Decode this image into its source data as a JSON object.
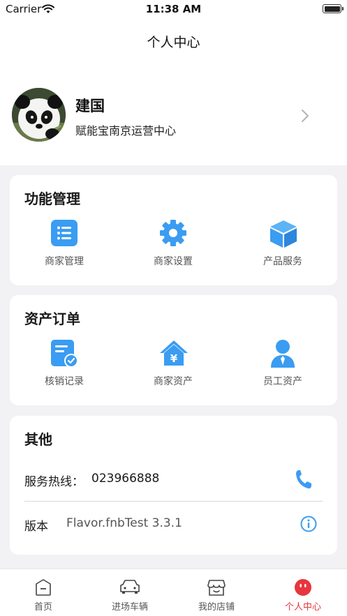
{
  "status_bar": {
    "carrier": "Carrier",
    "time": "11:38 AM"
  },
  "nav": {
    "title": "个人中心"
  },
  "profile": {
    "name": "建国",
    "subtitle": "赋能宝南京运营中心"
  },
  "functions": {
    "title": "功能管理",
    "items": [
      {
        "label": "商家管理",
        "icon": "list-icon"
      },
      {
        "label": "商家设置",
        "icon": "gear-icon"
      },
      {
        "label": "产品服务",
        "icon": "cube-icon"
      }
    ]
  },
  "assets": {
    "title": "资产订单",
    "items": [
      {
        "label": "核销记录",
        "icon": "verify-record-icon"
      },
      {
        "label": "商家资产",
        "icon": "house-yen-icon"
      },
      {
        "label": "员工资产",
        "icon": "employee-icon"
      }
    ]
  },
  "other": {
    "title": "其他",
    "hotline_label": "服务热线：",
    "hotline_value": "023966888",
    "version_label": "版本",
    "version_value": "Flavor.fnbTest 3.3.1"
  },
  "tabs": [
    {
      "label": "首页",
      "icon": "home-icon"
    },
    {
      "label": "进场车辆",
      "icon": "car-icon"
    },
    {
      "label": "我的店铺",
      "icon": "store-icon"
    },
    {
      "label": "个人中心",
      "icon": "profile-face-icon",
      "active": true
    }
  ],
  "colors": {
    "accent_blue": "#3a9cf2",
    "active_red": "#e8363d"
  }
}
